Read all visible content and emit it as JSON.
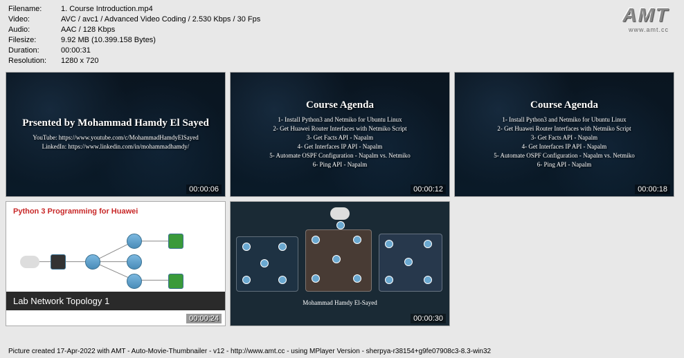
{
  "meta": {
    "filename_label": "Filename:",
    "filename": "1. Course Introduction.mp4",
    "video_label": "Video:",
    "video": "AVC / avc1 / Advanced Video Coding / 2.530 Kbps / 30 Fps",
    "audio_label": "Audio:",
    "audio": "AAC / 128 Kbps",
    "filesize_label": "Filesize:",
    "filesize": "9.92 MB (10.399.158 Bytes)",
    "duration_label": "Duration:",
    "duration": "00:00:31",
    "resolution_label": "Resolution:",
    "resolution": "1280 x 720"
  },
  "logo": {
    "text": "AMT",
    "sub": "www.amt.cc"
  },
  "thumbs": {
    "t1": {
      "title": "Prsented by Mohammad Hamdy El Sayed",
      "line1": "YouTube: https://www.youtube.com/c/MohammadHamdyElSayed",
      "line2": "LinkedIn: https://www.linkedin.com/in/mohammadhamdy/",
      "ts": "00:00:06"
    },
    "agenda": {
      "title": "Course Agenda",
      "l1": "1- Install Python3 and Netmiko for Ubuntu Linux",
      "l2": "2- Get Huawei Router Interfaces with Netmiko Script",
      "l3": "3- Get Facts API - Napalm",
      "l4": "4- Get Interfaces IP API - Napalm",
      "l5": "5- Automate OSPF Configuration - Napalm vs. Netmiko",
      "l6": "6- Ping API - Napalm"
    },
    "t2_ts": "00:00:12",
    "t3_ts": "00:00:18",
    "t4": {
      "header": "Python 3 Programming for Huawei",
      "bar": "Lab Network Topology 1",
      "ts": "00:00:24"
    },
    "t5": {
      "caption": "Mohammad Hamdy El-Sayed",
      "ts": "00:00:30"
    }
  },
  "footer": "Picture created 17-Apr-2022 with AMT - Auto-Movie-Thumbnailer - v12 - http://www.amt.cc - using MPlayer Version - sherpya-r38154+g9fe07908c3-8.3-win32"
}
